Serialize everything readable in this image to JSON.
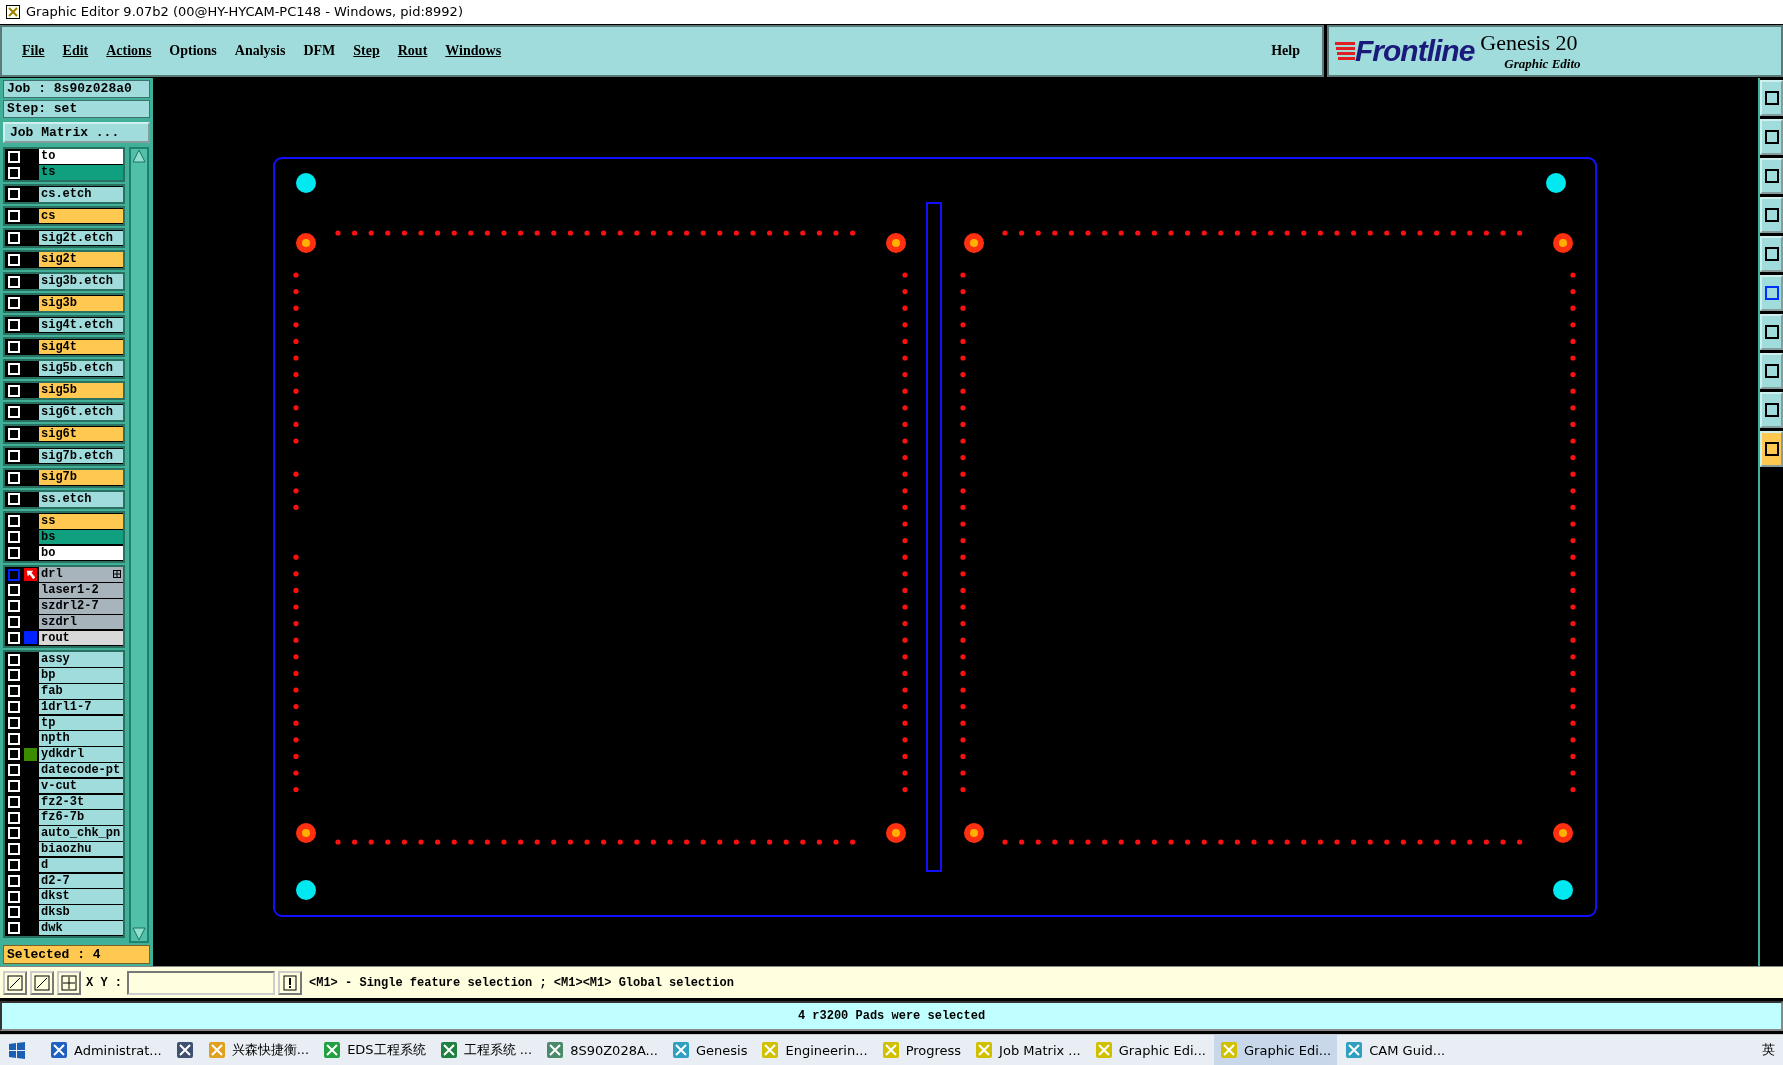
{
  "window": {
    "title": "Graphic Editor 9.07b2 (00@HY-HYCAM-PC148 - Windows, pid:8992)"
  },
  "menu": [
    "File",
    "Edit",
    "Actions",
    "Options",
    "Analysis",
    "DFM",
    "Step",
    "Rout",
    "Windows"
  ],
  "help": "Help",
  "logo": {
    "brand": "Frontline",
    "product": "Genesis 20",
    "subtitle": "Graphic Edito"
  },
  "job": {
    "job": "Job  : 8s90z028a0",
    "step": "Step: set",
    "matrix_button": "Job Matrix ..."
  },
  "layer_boxes": [
    [
      {
        "name": "to",
        "kind": "outer",
        "checked": false,
        "work": false
      },
      {
        "name": "ts",
        "kind": "mask",
        "checked": false,
        "work": false
      }
    ],
    [
      {
        "name": "cs.etch",
        "kind": "etch",
        "checked": false,
        "work": false
      }
    ],
    [
      {
        "name": "cs",
        "kind": "signal",
        "checked": false,
        "work": false
      }
    ],
    [
      {
        "name": "sig2t.etch",
        "kind": "etch",
        "checked": false,
        "work": false
      }
    ],
    [
      {
        "name": "sig2t",
        "kind": "signal",
        "checked": false,
        "work": false
      }
    ],
    [
      {
        "name": "sig3b.etch",
        "kind": "etch",
        "checked": false,
        "work": false
      }
    ],
    [
      {
        "name": "sig3b",
        "kind": "signal",
        "checked": false,
        "work": false
      }
    ],
    [
      {
        "name": "sig4t.etch",
        "kind": "etch",
        "checked": false,
        "work": false
      }
    ],
    [
      {
        "name": "sig4t",
        "kind": "signal",
        "checked": false,
        "work": false
      }
    ],
    [
      {
        "name": "sig5b.etch",
        "kind": "etch",
        "checked": false,
        "work": false
      }
    ],
    [
      {
        "name": "sig5b",
        "kind": "signal",
        "checked": false,
        "work": false
      }
    ],
    [
      {
        "name": "sig6t.etch",
        "kind": "etch",
        "checked": false,
        "work": false
      }
    ],
    [
      {
        "name": "sig6t",
        "kind": "signal",
        "checked": false,
        "work": false
      }
    ],
    [
      {
        "name": "sig7b.etch",
        "kind": "etch",
        "checked": false,
        "work": false
      }
    ],
    [
      {
        "name": "sig7b",
        "kind": "signal",
        "checked": false,
        "work": false
      }
    ],
    [
      {
        "name": "ss.etch",
        "kind": "etch",
        "checked": false,
        "work": false
      }
    ],
    [
      {
        "name": "ss",
        "kind": "signal",
        "checked": false,
        "work": false
      },
      {
        "name": "bs",
        "kind": "mask",
        "checked": false,
        "work": false
      },
      {
        "name": "bo",
        "kind": "outer",
        "checked": false,
        "work": false
      }
    ],
    [
      {
        "name": "drl",
        "kind": "drill",
        "checked": false,
        "work": true
      },
      {
        "name": "laser1-2",
        "kind": "drill",
        "checked": false,
        "work": false
      },
      {
        "name": "szdrl2-7",
        "kind": "drill",
        "checked": false,
        "work": false
      },
      {
        "name": "szdrl",
        "kind": "drill",
        "checked": false,
        "work": false
      },
      {
        "name": "rout",
        "kind": "rout",
        "checked": false,
        "work": false,
        "color": "#0022ff"
      }
    ],
    [
      {
        "name": "assy",
        "kind": "doc",
        "checked": false,
        "work": false
      },
      {
        "name": "bp",
        "kind": "doc",
        "checked": false,
        "work": false
      },
      {
        "name": "fab",
        "kind": "doc",
        "checked": false,
        "work": false
      },
      {
        "name": "1drl1-7",
        "kind": "doc",
        "checked": false,
        "work": false
      },
      {
        "name": "tp",
        "kind": "doc",
        "checked": false,
        "work": false
      },
      {
        "name": "npth",
        "kind": "doc",
        "checked": false,
        "work": false
      },
      {
        "name": "ydkdrl",
        "kind": "doc",
        "checked": false,
        "work": false,
        "color": "#3c8c00"
      },
      {
        "name": "datecode-pt",
        "kind": "doc",
        "checked": false,
        "work": false
      },
      {
        "name": "v-cut",
        "kind": "doc",
        "checked": false,
        "work": false
      },
      {
        "name": "fz2-3t",
        "kind": "doc",
        "checked": false,
        "work": false
      },
      {
        "name": "fz6-7b",
        "kind": "doc",
        "checked": false,
        "work": false
      },
      {
        "name": "auto_chk_pn",
        "kind": "doc",
        "checked": false,
        "work": false
      },
      {
        "name": "biaozhu",
        "kind": "doc",
        "checked": false,
        "work": false
      },
      {
        "name": "d",
        "kind": "doc",
        "checked": false,
        "work": false
      },
      {
        "name": "d2-7",
        "kind": "doc",
        "checked": false,
        "work": false
      },
      {
        "name": "dkst",
        "kind": "doc",
        "checked": false,
        "work": false
      },
      {
        "name": "dksb",
        "kind": "doc",
        "checked": false,
        "work": false
      },
      {
        "name": "dwk",
        "kind": "doc",
        "checked": false,
        "work": false
      }
    ]
  ],
  "selected_count": "Selected : 4",
  "command": {
    "xy_label": "X Y :",
    "prompt": "<M1> - Single feature selection ; <M1><M1> Global selection"
  },
  "status": "4 r3200 Pads were selected",
  "taskbar": [
    {
      "label": "Administrat...",
      "selected": false
    },
    {
      "selected": false
    },
    {
      "label": "兴森快捷衡...",
      "selected": false
    },
    {
      "label": "EDS工程系统",
      "selected": false
    },
    {
      "label": "工程系统    ...",
      "selected": false
    },
    {
      "label": "8S90Z028A...",
      "selected": false
    },
    {
      "label": "Genesis",
      "selected": false
    },
    {
      "label": "Engineerin...",
      "selected": false
    },
    {
      "label": "Progress",
      "selected": false
    },
    {
      "label": "Job Matrix ...",
      "selected": false
    },
    {
      "label": "Graphic Edi...",
      "selected": false
    },
    {
      "label": "Graphic Edi...",
      "selected": true
    },
    {
      "label": "CAM Guid...",
      "selected": false
    }
  ],
  "tray": {
    "ime": "英"
  }
}
